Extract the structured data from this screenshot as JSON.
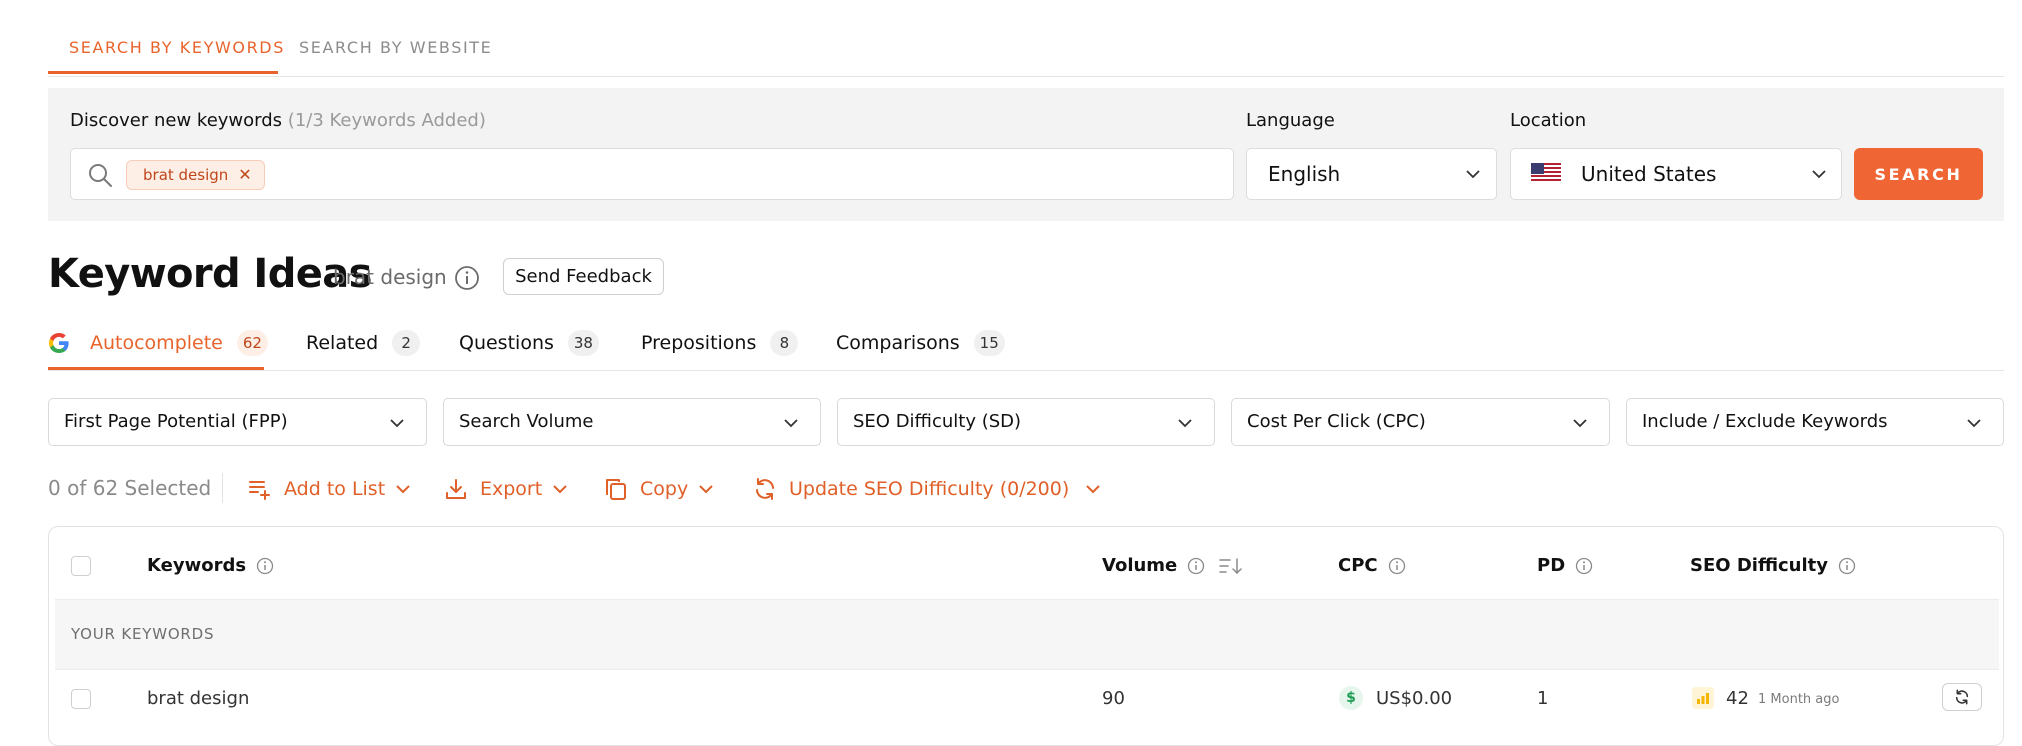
{
  "top_tabs": [
    {
      "label": "SEARCH BY KEYWORDS",
      "active": true
    },
    {
      "label": "SEARCH BY WEBSITE",
      "active": false
    }
  ],
  "search": {
    "label": "Discover new keywords",
    "label_count": "(1/3 Keywords Added)",
    "chips": [
      "brat design"
    ],
    "language_label": "Language",
    "language_value": "English",
    "location_label": "Location",
    "location_value": "United States",
    "button": "SEARCH"
  },
  "heading": {
    "title": "Keyword Ideas",
    "subtitle": "brat design",
    "feedback": "Send Feedback"
  },
  "tabs": [
    {
      "label": "Autocomplete",
      "count": "62",
      "active": true
    },
    {
      "label": "Related",
      "count": "2",
      "active": false
    },
    {
      "label": "Questions",
      "count": "38",
      "active": false
    },
    {
      "label": "Prepositions",
      "count": "8",
      "active": false
    },
    {
      "label": "Comparisons",
      "count": "15",
      "active": false
    }
  ],
  "filters": [
    "First Page Potential (FPP)",
    "Search Volume",
    "SEO Difficulty (SD)",
    "Cost Per Click (CPC)",
    "Include / Exclude Keywords"
  ],
  "toolbar": {
    "selected": "0 of 62 Selected",
    "actions": [
      "Add to List",
      "Export",
      "Copy",
      "Update SEO Difficulty (0/200)"
    ]
  },
  "table": {
    "columns": [
      "Keywords",
      "Volume",
      "CPC",
      "PD",
      "SEO Difficulty"
    ],
    "section_label": "YOUR KEYWORDS",
    "rows": [
      {
        "keyword": "brat design",
        "volume": "90",
        "cpc": "US$0.00",
        "pd": "1",
        "sd": "42",
        "updated": "1 Month ago"
      }
    ]
  },
  "colors": {
    "accent": "#e8642c",
    "button": "#ef6533",
    "panel_bg": "#f3f3f3",
    "cpc_badge": "#1f9d55",
    "sd_bar": "#f4b400"
  }
}
